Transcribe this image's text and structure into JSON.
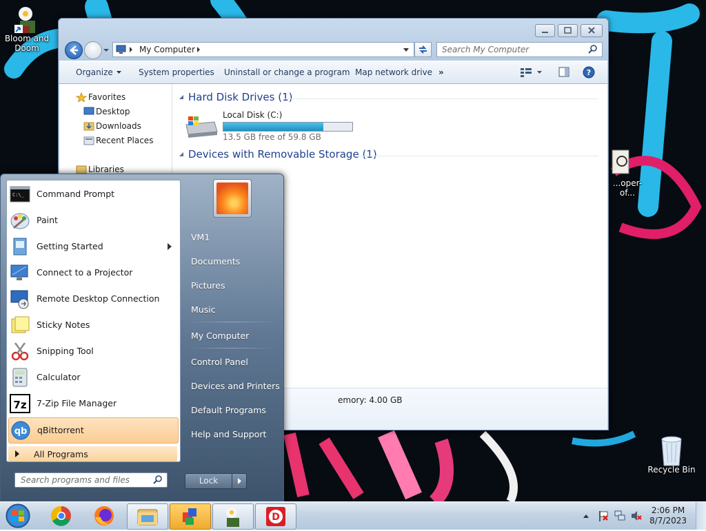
{
  "desktop": {
    "icons": [
      {
        "label": "Bloom and Doom"
      },
      {
        "label": "Recycle Bin"
      },
      {
        "label": "...oper-of..."
      }
    ]
  },
  "explorer": {
    "address": {
      "path": "My Computer"
    },
    "search": {
      "placeholder": "Search My Computer"
    },
    "toolbar": {
      "organize": "Organize",
      "system_properties": "System properties",
      "uninstall": "Uninstall or change a program",
      "map_network_drive": "Map network drive",
      "more": "»"
    },
    "nav": {
      "favorites": "Favorites",
      "desktop": "Desktop",
      "downloads": "Downloads",
      "recent_places": "Recent Places",
      "libraries": "Libraries"
    },
    "groups": {
      "hard_disks": "Hard Disk Drives (1)",
      "removable": "Devices with Removable Storage (1)"
    },
    "drive": {
      "name": "Local Disk (C:)",
      "free_text": "13.5 GB free of 59.8 GB",
      "used_fraction": 0.774
    },
    "details": {
      "memory": "emory: 4.00 GB"
    }
  },
  "start_menu": {
    "programs": [
      {
        "label": "Command Prompt",
        "icon": "cmd-icon"
      },
      {
        "label": "Paint",
        "icon": "paint-icon"
      },
      {
        "label": "Getting Started",
        "icon": "getting-started-icon",
        "submenu": true
      },
      {
        "label": "Connect to a Projector",
        "icon": "projector-icon"
      },
      {
        "label": "Remote Desktop Connection",
        "icon": "remote-desktop-icon"
      },
      {
        "label": "Sticky Notes",
        "icon": "sticky-notes-icon"
      },
      {
        "label": "Snipping Tool",
        "icon": "snipping-tool-icon"
      },
      {
        "label": "Calculator",
        "icon": "calculator-icon"
      },
      {
        "label": "7-Zip File Manager",
        "icon": "7zip-icon"
      },
      {
        "label": "qBittorrent",
        "icon": "qbittorrent-icon",
        "selected": true
      }
    ],
    "all_programs": "All Programs",
    "search_placeholder": "Search programs and files",
    "right_items": {
      "user": "VM1",
      "documents": "Documents",
      "pictures": "Pictures",
      "music": "Music",
      "my_computer": "My Computer",
      "control_panel": "Control Panel",
      "devices_printers": "Devices and Printers",
      "default_programs": "Default Programs",
      "help_support": "Help and Support"
    },
    "lock": "Lock"
  },
  "taskbar": {
    "time": "2:06 PM",
    "date": "8/7/2023",
    "apps": [
      "chrome-icon",
      "firefox-icon",
      "explorer-icon",
      "paint-3d-icon",
      "bloom-doom-icon",
      "game-icon"
    ]
  }
}
